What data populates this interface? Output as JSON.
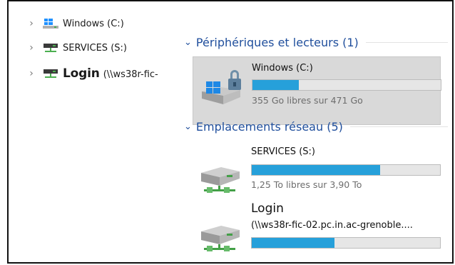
{
  "nav": {
    "items": [
      {
        "label": "Windows (C:)",
        "icon": "windows-drive-icon"
      },
      {
        "label": "SERVICES (S:)",
        "icon": "network-drive-icon"
      },
      {
        "label": "Login",
        "sub": "(\\\\ws38r-fic-",
        "icon": "network-drive-icon"
      }
    ]
  },
  "groups": {
    "devices": {
      "title": "Périphériques et lecteurs (1)",
      "drives": [
        {
          "name": "Windows (C:)",
          "free_text": "355 Go libres sur 471 Go",
          "used_fraction": 0.246
        }
      ]
    },
    "network": {
      "title": "Emplacements réseau (5)",
      "drives": [
        {
          "name": "SERVICES (S:)",
          "free_text": "1,25 To libres sur 3,90 To",
          "used_fraction": 0.68
        },
        {
          "name": "Login",
          "path": "(\\\\ws38r-fic-02.pc.in.ac-grenoble....",
          "used_fraction": 0.44
        }
      ]
    }
  },
  "colors": {
    "accent": "#26a0da",
    "group_header": "#1f4e9c",
    "selected_bg": "#d9d9d9"
  }
}
